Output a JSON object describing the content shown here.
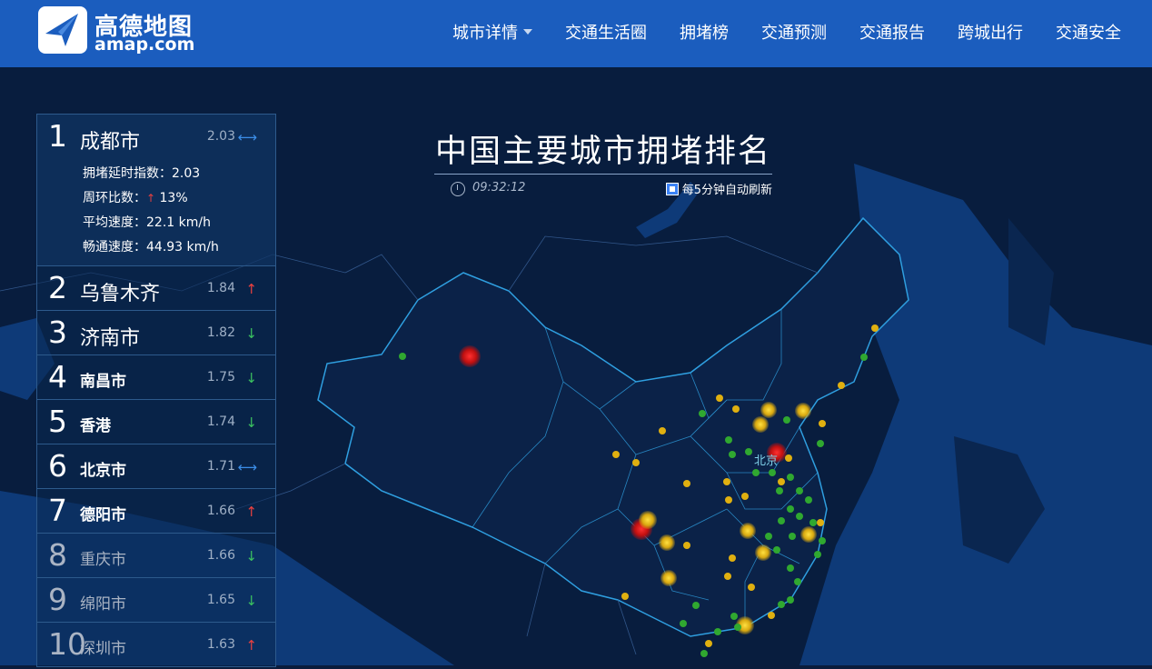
{
  "header": {
    "logo_cn": "高德地图",
    "logo_en": "amap.com",
    "nav": [
      {
        "label": "城市详情",
        "dropdown": true
      },
      {
        "label": "交通生活圈"
      },
      {
        "label": "拥堵榜"
      },
      {
        "label": "交通预测"
      },
      {
        "label": "交通报告"
      },
      {
        "label": "跨城出行"
      },
      {
        "label": "交通安全"
      }
    ]
  },
  "title": {
    "text": "中国主要城市拥堵排名",
    "time": "09:32:12",
    "refresh": "每5分钟自动刷新"
  },
  "map": {
    "city_label": "北京",
    "colors": {
      "red": "#e02020",
      "yellow": "#f0c010",
      "green": "#30b030"
    }
  },
  "ranking": [
    {
      "rank": "1",
      "city": "成都市",
      "index": "2.03",
      "trend": "flat",
      "details": [
        {
          "label": "拥堵延时指数：",
          "value": "2.03"
        },
        {
          "label": "周环比数：",
          "arrow": "↑",
          "value": "13%"
        },
        {
          "label": "平均速度：",
          "value": "22.1 km/h"
        },
        {
          "label": "畅通速度：",
          "value": "44.93 km/h"
        }
      ]
    },
    {
      "rank": "2",
      "city": "乌鲁木齐",
      "index": "1.84",
      "trend": "up"
    },
    {
      "rank": "3",
      "city": "济南市",
      "index": "1.82",
      "trend": "down"
    },
    {
      "rank": "4",
      "city": "南昌市",
      "index": "1.75",
      "trend": "down"
    },
    {
      "rank": "5",
      "city": "香港",
      "index": "1.74",
      "trend": "down"
    },
    {
      "rank": "6",
      "city": "北京市",
      "index": "1.71",
      "trend": "flat"
    },
    {
      "rank": "7",
      "city": "德阳市",
      "index": "1.66",
      "trend": "up"
    },
    {
      "rank": "8",
      "city": "重庆市",
      "index": "1.66",
      "trend": "down"
    },
    {
      "rank": "9",
      "city": "绵阳市",
      "index": "1.65",
      "trend": "down"
    },
    {
      "rank": "10",
      "city": "深圳市",
      "index": "1.63",
      "trend": "up"
    }
  ]
}
